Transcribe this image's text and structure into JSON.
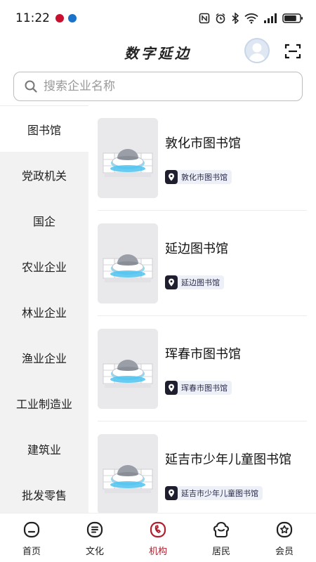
{
  "status_bar": {
    "time": "11:22",
    "battery_level": 0.8
  },
  "header": {
    "title": "数字延边"
  },
  "search": {
    "placeholder": "搜索企业名称"
  },
  "sidebar": {
    "active_index": 0,
    "items": [
      {
        "label": "图书馆"
      },
      {
        "label": "党政机关"
      },
      {
        "label": "国企"
      },
      {
        "label": "农业企业"
      },
      {
        "label": "林业企业"
      },
      {
        "label": "渔业企业"
      },
      {
        "label": "工业制造业"
      },
      {
        "label": "建筑业"
      },
      {
        "label": "批发零售"
      }
    ]
  },
  "list": {
    "items": [
      {
        "title": "敦化市图书馆",
        "tag": "敦化市图书馆"
      },
      {
        "title": "延边图书馆",
        "tag": "延边图书馆"
      },
      {
        "title": "珲春市图书馆",
        "tag": "珲春市图书馆"
      },
      {
        "title": "延吉市少年儿童图书馆",
        "tag": "延吉市少年儿童图书馆"
      }
    ]
  },
  "bottom_nav": {
    "active_index": 2,
    "items": [
      {
        "label": "首页",
        "icon": "home-icon"
      },
      {
        "label": "文化",
        "icon": "culture-icon"
      },
      {
        "label": "机构",
        "icon": "institution-icon"
      },
      {
        "label": "居民",
        "icon": "resident-icon"
      },
      {
        "label": "会员",
        "icon": "member-icon"
      }
    ]
  },
  "colors": {
    "accent": "#b11e2c",
    "sidebar_bg": "#f2f2f2",
    "tag_bg": "#eef0f8",
    "tag_icon_bg": "#1e1e2e"
  }
}
